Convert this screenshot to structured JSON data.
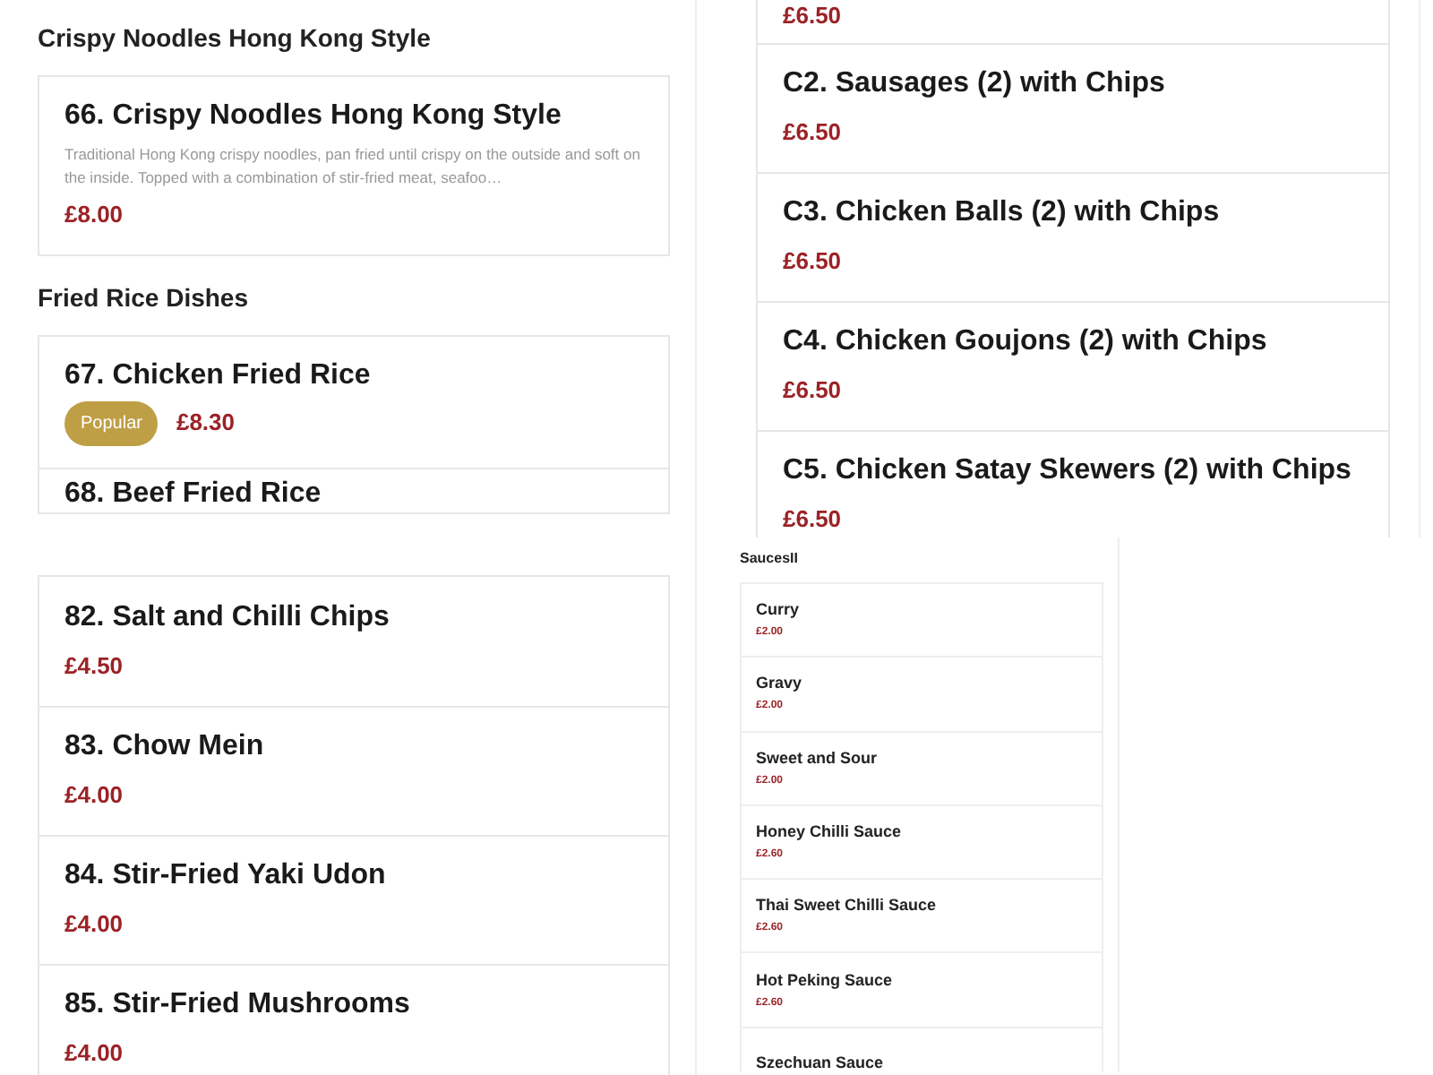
{
  "top_left": {
    "sections": [
      {
        "heading": "Crispy Noodles Hong Kong Style",
        "items": [
          {
            "name": "66. Crispy Noodles Hong Kong Style",
            "description": "Traditional Hong Kong crispy noodles, pan fried until crispy on the outside and soft on the inside. Topped with a combination of stir-fried meat, seafoo…",
            "price": "£8.00"
          }
        ]
      },
      {
        "heading": "Fried Rice Dishes",
        "items": [
          {
            "name": "67. Chicken Fried Rice",
            "badge": "Popular",
            "price": "£8.30"
          },
          {
            "name": "68. Beef Fried Rice"
          }
        ]
      }
    ]
  },
  "top_right": {
    "items": [
      {
        "price": "£6.50"
      },
      {
        "name": "C2. Sausages (2) with Chips",
        "price": "£6.50"
      },
      {
        "name": "C3. Chicken Balls (2) with Chips",
        "price": "£6.50"
      },
      {
        "name": "C4. Chicken Goujons (2) with Chips",
        "price": "£6.50"
      },
      {
        "name": "C5. Chicken Satay Skewers (2) with Chips",
        "price": "£6.50"
      }
    ]
  },
  "bottom_left": {
    "items": [
      {
        "name": "82. Salt and Chilli Chips",
        "price": "£4.50"
      },
      {
        "name": "83. Chow Mein",
        "price": "£4.00"
      },
      {
        "name": "84. Stir-Fried Yaki Udon",
        "price": "£4.00"
      },
      {
        "name": "85. Stir-Fried Mushrooms",
        "price": "£4.00"
      }
    ]
  },
  "bottom_middle": {
    "heading": "SaucesII",
    "items": [
      {
        "name": "Curry",
        "price": "£2.00"
      },
      {
        "name": "Gravy",
        "price": "£2.00"
      },
      {
        "name": "Sweet and Sour",
        "price": "£2.00"
      },
      {
        "name": "Honey Chilli Sauce",
        "price": "£2.60"
      },
      {
        "name": "Thai Sweet Chilli Sauce",
        "price": "£2.60"
      },
      {
        "name": "Hot Peking Sauce",
        "price": "£2.60"
      },
      {
        "name": "Szechuan Sauce"
      }
    ]
  }
}
